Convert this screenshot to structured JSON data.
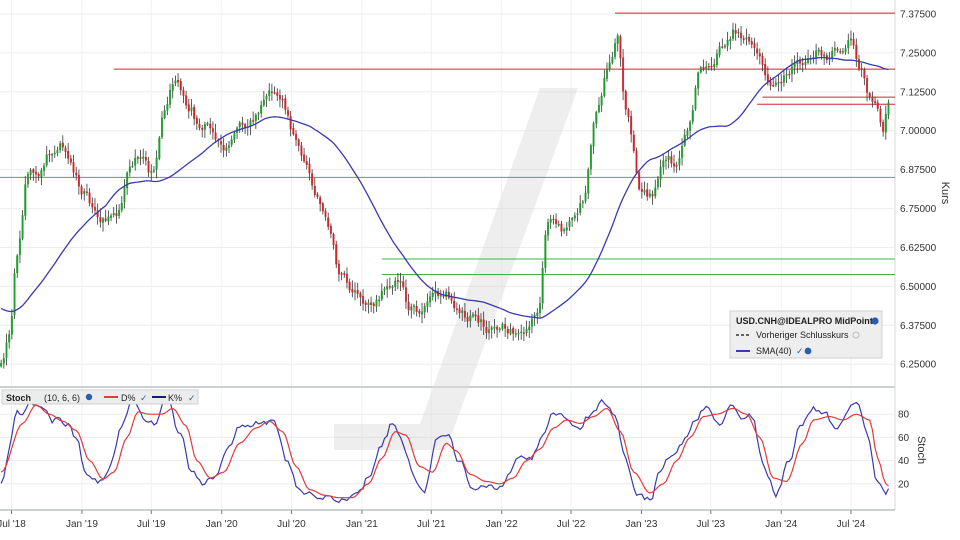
{
  "chart_data": [
    {
      "type": "candlestick",
      "title": "",
      "xlabel": "",
      "ylabel": "Kurs",
      "ylim": [
        6.18,
        7.42
      ],
      "grid": true,
      "legend_position": "bottom-right",
      "colors": {
        "up": "#1e9e2e",
        "down": "#d0262b",
        "sma": "#3a3ab0",
        "resistance": "#d0262b",
        "support": "#3cb44b"
      },
      "x_ticks": [
        "Jul '18",
        "Jan '19",
        "Jul '19",
        "Jan '20",
        "Jul '20",
        "Jan '21",
        "Jul '21",
        "Jan '22",
        "Jul '22",
        "Jan '23",
        "Jul '23",
        "Jan '24",
        "Jul '24"
      ],
      "y_ticks": [
        "7.37500",
        "7.25000",
        "7.12500",
        "7.00000",
        "6.87500",
        "6.75000",
        "6.62500",
        "6.50000",
        "6.37500",
        "6.25000"
      ],
      "legend": {
        "title": "USD.CNH@IDEALPRO MidPoint",
        "items": [
          "Vorheriger Schlusskurs",
          "SMA(40)"
        ]
      },
      "close_series_weekly": {
        "start": "2018-06-04",
        "step": "1 week",
        "anchors": [
          [
            "2018-06-04",
            6.26
          ],
          [
            "2018-06-25",
            6.36
          ],
          [
            "2018-07-16",
            6.62
          ],
          [
            "2018-08-13",
            6.86
          ],
          [
            "2018-09-10",
            6.86
          ],
          [
            "2018-10-08",
            6.93
          ],
          [
            "2018-11-05",
            6.95
          ],
          [
            "2018-12-03",
            6.88
          ],
          [
            "2019-01-07",
            6.8
          ],
          [
            "2019-02-04",
            6.73
          ],
          [
            "2019-03-04",
            6.71
          ],
          [
            "2019-04-01",
            6.72
          ],
          [
            "2019-05-06",
            6.88
          ],
          [
            "2019-06-03",
            6.92
          ],
          [
            "2019-07-01",
            6.86
          ],
          [
            "2019-08-05",
            7.06
          ],
          [
            "2019-09-02",
            7.17
          ],
          [
            "2019-10-07",
            7.08
          ],
          [
            "2019-11-04",
            7.02
          ],
          [
            "2019-12-02",
            7.01
          ],
          [
            "2020-01-06",
            6.93
          ],
          [
            "2020-02-03",
            6.99
          ],
          [
            "2020-03-02",
            7.02
          ],
          [
            "2020-04-06",
            7.06
          ],
          [
            "2020-05-04",
            7.13
          ],
          [
            "2020-06-01",
            7.1
          ],
          [
            "2020-07-06",
            7.0
          ],
          [
            "2020-08-03",
            6.92
          ],
          [
            "2020-09-07",
            6.8
          ],
          [
            "2020-10-05",
            6.7
          ],
          [
            "2020-11-02",
            6.55
          ],
          [
            "2020-12-07",
            6.5
          ],
          [
            "2021-01-04",
            6.45
          ],
          [
            "2021-02-01",
            6.44
          ],
          [
            "2021-03-01",
            6.48
          ],
          [
            "2021-04-05",
            6.52
          ],
          [
            "2021-05-03",
            6.44
          ],
          [
            "2021-06-07",
            6.41
          ],
          [
            "2021-07-05",
            6.47
          ],
          [
            "2021-08-02",
            6.48
          ],
          [
            "2021-09-06",
            6.44
          ],
          [
            "2021-10-04",
            6.41
          ],
          [
            "2021-11-01",
            6.39
          ],
          [
            "2021-12-06",
            6.36
          ],
          [
            "2022-01-03",
            6.37
          ],
          [
            "2022-02-07",
            6.35
          ],
          [
            "2022-03-07",
            6.35
          ],
          [
            "2022-04-04",
            6.4
          ],
          [
            "2022-05-02",
            6.72
          ],
          [
            "2022-06-06",
            6.68
          ],
          [
            "2022-07-04",
            6.73
          ],
          [
            "2022-08-01",
            6.77
          ],
          [
            "2022-09-05",
            7.05
          ],
          [
            "2022-10-10",
            7.22
          ],
          [
            "2022-10-31",
            7.3
          ],
          [
            "2022-11-21",
            7.08
          ],
          [
            "2023-01-02",
            6.79
          ],
          [
            "2023-01-30",
            6.79
          ],
          [
            "2023-03-06",
            6.92
          ],
          [
            "2023-04-03",
            6.88
          ],
          [
            "2023-05-01",
            6.98
          ],
          [
            "2023-06-05",
            7.2
          ],
          [
            "2023-07-03",
            7.22
          ],
          [
            "2023-08-07",
            7.28
          ],
          [
            "2023-09-04",
            7.32
          ],
          [
            "2023-10-02",
            7.3
          ],
          [
            "2023-11-06",
            7.23
          ],
          [
            "2023-12-04",
            7.14
          ],
          [
            "2024-01-08",
            7.17
          ],
          [
            "2024-02-05",
            7.2
          ],
          [
            "2024-03-04",
            7.23
          ],
          [
            "2024-04-08",
            7.25
          ],
          [
            "2024-05-06",
            7.24
          ],
          [
            "2024-06-03",
            7.27
          ],
          [
            "2024-07-01",
            7.29
          ],
          [
            "2024-07-29",
            7.2
          ],
          [
            "2024-08-19",
            7.1
          ],
          [
            "2024-09-09",
            7.07
          ],
          [
            "2024-09-23",
            7.01
          ],
          [
            "2024-10-07",
            7.09
          ]
        ]
      },
      "sma_period": 40,
      "horizontal_lines": [
        {
          "role": "resistance",
          "value": 7.378,
          "from": "2022-10-24",
          "to": "end"
        },
        {
          "role": "resistance",
          "value": 7.198,
          "from": "2019-03-25",
          "to": "end"
        },
        {
          "role": "resistance",
          "value": 7.108,
          "from": "2023-11-13",
          "to": "end"
        },
        {
          "role": "resistance",
          "value": 7.085,
          "from": "2023-10-30",
          "to": "end"
        },
        {
          "role": "support",
          "value": 6.85,
          "from": "start",
          "to": "end"
        },
        {
          "role": "support",
          "value": 6.588,
          "from": "2021-02-22",
          "to": "end"
        },
        {
          "role": "support",
          "value": 6.538,
          "from": "2021-02-22",
          "to": "end"
        }
      ]
    },
    {
      "type": "line",
      "title": "Stoch",
      "ylabel": "Stoch",
      "ylim": [
        0,
        100
      ],
      "y_ticks": [
        "80",
        "60",
        "40",
        "20"
      ],
      "legend": {
        "header": "Stoch",
        "params": "(10, 6, 6)",
        "items": [
          "D%",
          "K%"
        ]
      },
      "colors": {
        "D": "#e23b3b",
        "K": "#3a3ab0"
      },
      "series": [
        {
          "name": "K%",
          "anchors": [
            [
              "2018-06-04",
              20
            ],
            [
              "2018-07-16",
              80
            ],
            [
              "2018-08-27",
              88
            ],
            [
              "2018-09-24",
              84
            ],
            [
              "2018-10-15",
              75
            ],
            [
              "2018-11-19",
              72
            ],
            [
              "2018-12-17",
              60
            ],
            [
              "2019-01-14",
              25
            ],
            [
              "2019-02-18",
              22
            ],
            [
              "2019-03-18",
              38
            ],
            [
              "2019-04-15",
              70
            ],
            [
              "2019-05-13",
              90
            ],
            [
              "2019-06-10",
              75
            ],
            [
              "2019-07-08",
              72
            ],
            [
              "2019-08-12",
              92
            ],
            [
              "2019-09-16",
              60
            ],
            [
              "2019-10-14",
              30
            ],
            [
              "2019-11-11",
              22
            ],
            [
              "2019-12-16",
              25
            ],
            [
              "2020-01-20",
              50
            ],
            [
              "2020-02-17",
              68
            ],
            [
              "2020-03-23",
              72
            ],
            [
              "2020-04-20",
              75
            ],
            [
              "2020-05-18",
              72
            ],
            [
              "2020-06-22",
              40
            ],
            [
              "2020-07-20",
              15
            ],
            [
              "2020-08-24",
              10
            ],
            [
              "2020-09-21",
              8
            ],
            [
              "2020-10-26",
              6
            ],
            [
              "2020-11-23",
              5
            ],
            [
              "2020-12-21",
              10
            ],
            [
              "2021-01-25",
              30
            ],
            [
              "2021-02-22",
              55
            ],
            [
              "2021-03-22",
              72
            ],
            [
              "2021-04-19",
              55
            ],
            [
              "2021-05-17",
              25
            ],
            [
              "2021-06-14",
              15
            ],
            [
              "2021-07-19",
              58
            ],
            [
              "2021-08-16",
              62
            ],
            [
              "2021-09-13",
              38
            ],
            [
              "2021-10-18",
              18
            ],
            [
              "2021-11-15",
              22
            ],
            [
              "2021-12-20",
              15
            ],
            [
              "2022-01-24",
              30
            ],
            [
              "2022-02-21",
              45
            ],
            [
              "2022-03-21",
              42
            ],
            [
              "2022-04-18",
              60
            ],
            [
              "2022-05-16",
              80
            ],
            [
              "2022-06-20",
              75
            ],
            [
              "2022-07-18",
              68
            ],
            [
              "2022-08-22",
              80
            ],
            [
              "2022-09-19",
              90
            ],
            [
              "2022-10-24",
              82
            ],
            [
              "2022-11-21",
              40
            ],
            [
              "2022-12-19",
              12
            ],
            [
              "2023-01-23",
              6
            ],
            [
              "2023-02-20",
              30
            ],
            [
              "2023-03-20",
              45
            ],
            [
              "2023-04-17",
              55
            ],
            [
              "2023-05-22",
              78
            ],
            [
              "2023-06-19",
              88
            ],
            [
              "2023-07-24",
              70
            ],
            [
              "2023-08-21",
              92
            ],
            [
              "2023-09-18",
              75
            ],
            [
              "2023-10-16",
              78
            ],
            [
              "2023-11-20",
              32
            ],
            [
              "2023-12-18",
              10
            ],
            [
              "2024-01-22",
              38
            ],
            [
              "2024-02-19",
              70
            ],
            [
              "2024-03-18",
              85
            ],
            [
              "2024-04-22",
              80
            ],
            [
              "2024-05-20",
              70
            ],
            [
              "2024-06-17",
              78
            ],
            [
              "2024-07-15",
              90
            ],
            [
              "2024-08-12",
              65
            ],
            [
              "2024-09-09",
              22
            ],
            [
              "2024-09-30",
              10
            ],
            [
              "2024-10-07",
              18
            ]
          ]
        },
        {
          "name": "D%",
          "anchors": [
            [
              "2018-06-04",
              30
            ],
            [
              "2018-07-30",
              72
            ],
            [
              "2018-09-03",
              88
            ],
            [
              "2018-10-08",
              80
            ],
            [
              "2018-11-12",
              74
            ],
            [
              "2018-12-17",
              66
            ],
            [
              "2019-01-21",
              40
            ],
            [
              "2019-02-25",
              24
            ],
            [
              "2019-03-25",
              30
            ],
            [
              "2019-04-29",
              60
            ],
            [
              "2019-05-27",
              82
            ],
            [
              "2019-06-24",
              80
            ],
            [
              "2019-07-29",
              80
            ],
            [
              "2019-08-26",
              85
            ],
            [
              "2019-09-30",
              70
            ],
            [
              "2019-10-28",
              40
            ],
            [
              "2019-12-02",
              25
            ],
            [
              "2020-01-06",
              30
            ],
            [
              "2020-02-17",
              55
            ],
            [
              "2020-03-30",
              68
            ],
            [
              "2020-05-04",
              74
            ],
            [
              "2020-06-08",
              65
            ],
            [
              "2020-07-13",
              35
            ],
            [
              "2020-08-17",
              15
            ],
            [
              "2020-09-28",
              10
            ],
            [
              "2020-11-02",
              8
            ],
            [
              "2020-12-07",
              8
            ],
            [
              "2021-01-18",
              20
            ],
            [
              "2021-02-22",
              42
            ],
            [
              "2021-03-29",
              65
            ],
            [
              "2021-04-26",
              62
            ],
            [
              "2021-05-31",
              35
            ],
            [
              "2021-07-05",
              30
            ],
            [
              "2021-08-09",
              55
            ],
            [
              "2021-09-06",
              48
            ],
            [
              "2021-10-11",
              28
            ],
            [
              "2021-11-22",
              22
            ],
            [
              "2021-12-27",
              20
            ],
            [
              "2022-01-31",
              25
            ],
            [
              "2022-03-07",
              40
            ],
            [
              "2022-04-11",
              50
            ],
            [
              "2022-05-16",
              68
            ],
            [
              "2022-06-20",
              75
            ],
            [
              "2022-07-25",
              72
            ],
            [
              "2022-08-29",
              78
            ],
            [
              "2022-10-03",
              85
            ],
            [
              "2022-11-07",
              65
            ],
            [
              "2022-12-12",
              30
            ],
            [
              "2023-01-23",
              12
            ],
            [
              "2023-02-27",
              20
            ],
            [
              "2023-04-03",
              40
            ],
            [
              "2023-05-08",
              60
            ],
            [
              "2023-06-12",
              78
            ],
            [
              "2023-07-17",
              80
            ],
            [
              "2023-08-28",
              85
            ],
            [
              "2023-10-02",
              80
            ],
            [
              "2023-11-06",
              60
            ],
            [
              "2023-12-11",
              25
            ],
            [
              "2024-01-15",
              22
            ],
            [
              "2024-02-26",
              55
            ],
            [
              "2024-03-25",
              75
            ],
            [
              "2024-05-06",
              78
            ],
            [
              "2024-06-10",
              75
            ],
            [
              "2024-07-15",
              80
            ],
            [
              "2024-08-19",
              75
            ],
            [
              "2024-09-09",
              42
            ],
            [
              "2024-09-30",
              20
            ],
            [
              "2024-10-07",
              18
            ]
          ]
        }
      ]
    }
  ]
}
